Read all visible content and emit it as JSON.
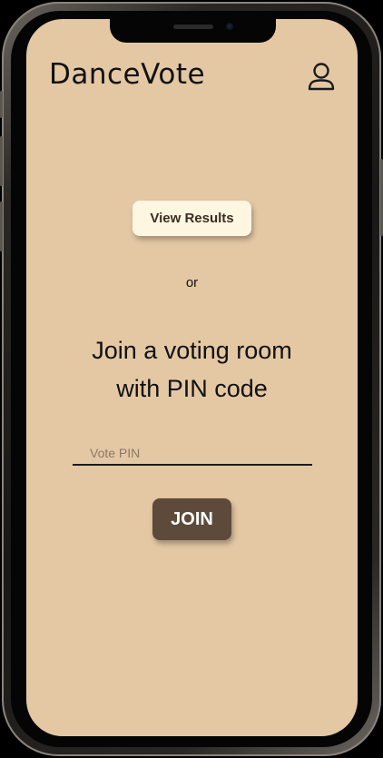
{
  "header": {
    "title": "DanceVote",
    "profile_icon": "user-icon"
  },
  "main": {
    "view_results_label": "View Results",
    "separator": "or",
    "join_heading_line1": "Join a voting room",
    "join_heading_line2": "with PIN code",
    "pin_placeholder": "Vote PIN",
    "pin_value": "",
    "join_label": "JOIN"
  },
  "colors": {
    "background": "#e4c8a4",
    "primary_button": "#5d4a3a",
    "secondary_button": "#fdf6e0",
    "text": "#111111"
  }
}
